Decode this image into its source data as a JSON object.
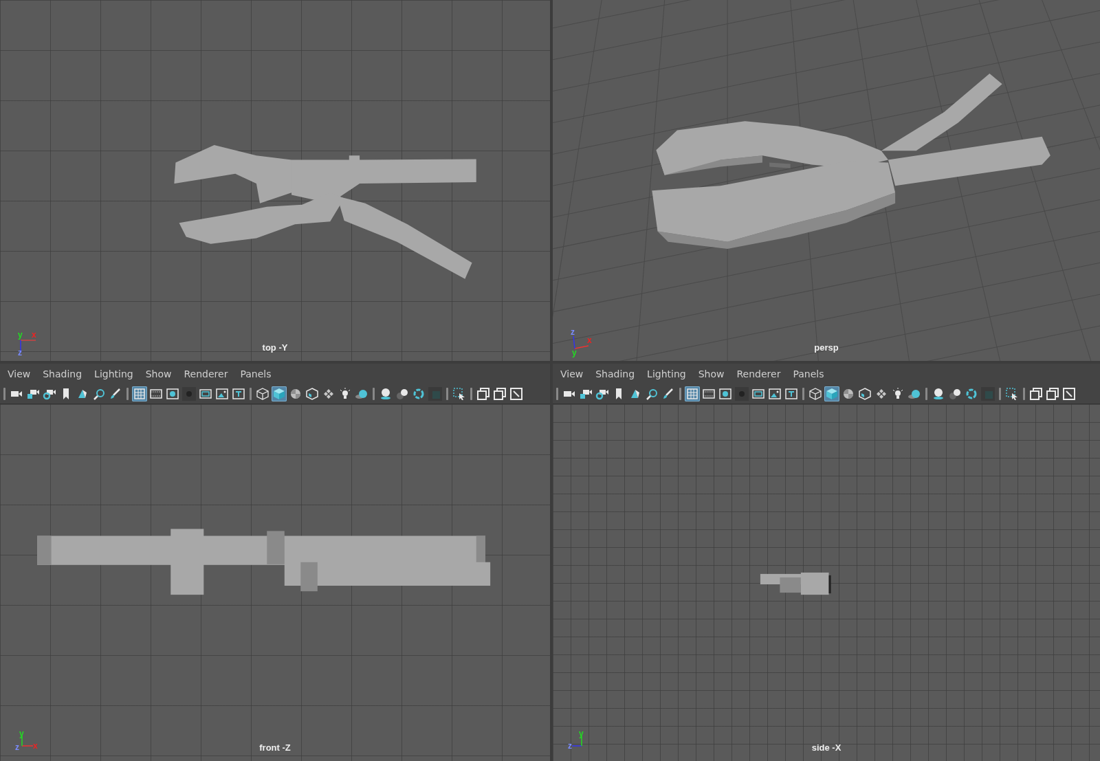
{
  "viewports": [
    {
      "kind": "top",
      "label": "top -Y",
      "axes": [
        {
          "label": "y",
          "color": "#22dd22"
        },
        {
          "label": "x",
          "color": "#ee2222"
        },
        {
          "label": "z",
          "color": "#7a8cff"
        }
      ]
    },
    {
      "kind": "persp",
      "label": "persp",
      "axes": [
        {
          "label": "z",
          "color": "#7a8cff"
        },
        {
          "label": "x",
          "color": "#ee2222"
        },
        {
          "label": "y",
          "color": "#22dd22"
        }
      ]
    },
    {
      "kind": "front",
      "label": "front -Z",
      "menu": [
        "View",
        "Shading",
        "Lighting",
        "Show",
        "Renderer",
        "Panels"
      ],
      "axes": [
        {
          "label": "y",
          "color": "#22dd22"
        },
        {
          "label": "z",
          "color": "#7a8cff"
        },
        {
          "label": "x",
          "color": "#ee2222"
        }
      ],
      "toolbar": [
        {
          "kind": "sep"
        },
        {
          "kind": "camera",
          "selected": false
        },
        {
          "kind": "camera-lock",
          "selected": false
        },
        {
          "kind": "camera-gear",
          "selected": false
        },
        {
          "kind": "bookmark",
          "selected": false
        },
        {
          "kind": "plane",
          "selected": false
        },
        {
          "kind": "zoom",
          "selected": false
        },
        {
          "kind": "brush",
          "selected": false
        },
        {
          "kind": "sep"
        },
        {
          "kind": "grid",
          "selected": true
        },
        {
          "kind": "film",
          "selected": false
        },
        {
          "kind": "circle-frame",
          "selected": false
        },
        {
          "kind": "dark-circle",
          "selected": false
        },
        {
          "kind": "frame",
          "selected": false
        },
        {
          "kind": "image",
          "selected": false
        },
        {
          "kind": "text-frame",
          "selected": false
        },
        {
          "kind": "sep"
        },
        {
          "kind": "wire-cube",
          "selected": false
        },
        {
          "kind": "shaded-cube",
          "selected": true
        },
        {
          "kind": "checker-sphere",
          "selected": false
        },
        {
          "kind": "textured-cube",
          "selected": false
        },
        {
          "kind": "tiles",
          "selected": false
        },
        {
          "kind": "bulb",
          "selected": false
        },
        {
          "kind": "shadow-sphere",
          "selected": false
        },
        {
          "kind": "sep"
        },
        {
          "kind": "ground-sphere",
          "selected": false
        },
        {
          "kind": "two-spheres",
          "selected": false
        },
        {
          "kind": "ring",
          "selected": false
        },
        {
          "kind": "dark-square",
          "selected": false
        },
        {
          "kind": "sep"
        },
        {
          "kind": "select-box",
          "selected": false
        },
        {
          "kind": "sep"
        },
        {
          "kind": "stack",
          "selected": false
        },
        {
          "kind": "stack",
          "selected": false
        },
        {
          "kind": "resize",
          "selected": false
        }
      ]
    },
    {
      "kind": "side",
      "label": "side -X",
      "menu": [
        "View",
        "Shading",
        "Lighting",
        "Show",
        "Renderer",
        "Panels"
      ],
      "axes": [
        {
          "label": "y",
          "color": "#22dd22"
        },
        {
          "label": "z",
          "color": "#7a8cff"
        }
      ],
      "toolbar": [
        {
          "kind": "sep"
        },
        {
          "kind": "camera",
          "selected": false
        },
        {
          "kind": "camera-lock",
          "selected": false
        },
        {
          "kind": "camera-gear",
          "selected": false
        },
        {
          "kind": "bookmark",
          "selected": false
        },
        {
          "kind": "plane",
          "selected": false
        },
        {
          "kind": "zoom",
          "selected": false
        },
        {
          "kind": "brush",
          "selected": false
        },
        {
          "kind": "sep"
        },
        {
          "kind": "grid",
          "selected": true
        },
        {
          "kind": "film",
          "selected": false
        },
        {
          "kind": "circle-frame",
          "selected": false
        },
        {
          "kind": "dark-circle",
          "selected": false
        },
        {
          "kind": "frame",
          "selected": false
        },
        {
          "kind": "image",
          "selected": false
        },
        {
          "kind": "text-frame",
          "selected": false
        },
        {
          "kind": "sep"
        },
        {
          "kind": "wire-cube",
          "selected": false
        },
        {
          "kind": "shaded-cube",
          "selected": true
        },
        {
          "kind": "checker-sphere",
          "selected": false
        },
        {
          "kind": "textured-cube",
          "selected": false
        },
        {
          "kind": "tiles",
          "selected": false
        },
        {
          "kind": "bulb",
          "selected": false
        },
        {
          "kind": "shadow-sphere",
          "selected": false
        },
        {
          "kind": "sep"
        },
        {
          "kind": "ground-sphere",
          "selected": false
        },
        {
          "kind": "two-spheres",
          "selected": false
        },
        {
          "kind": "ring",
          "selected": false
        },
        {
          "kind": "dark-square",
          "selected": false
        },
        {
          "kind": "sep"
        },
        {
          "kind": "select-box",
          "selected": false
        },
        {
          "kind": "sep"
        },
        {
          "kind": "stack",
          "selected": false
        },
        {
          "kind": "stack",
          "selected": false
        },
        {
          "kind": "resize",
          "selected": false
        }
      ]
    }
  ]
}
